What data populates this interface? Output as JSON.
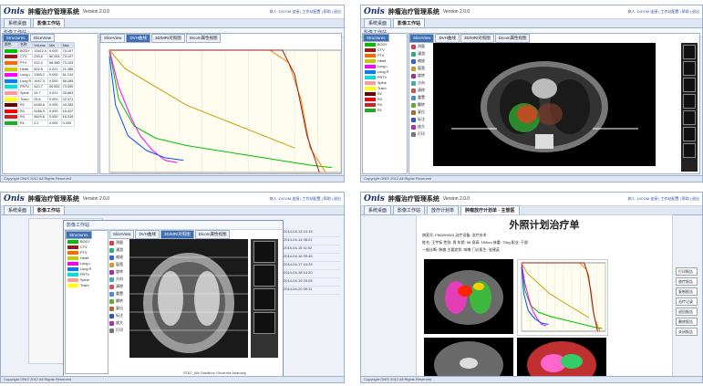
{
  "app": {
    "logo": "Onis",
    "title": "肿瘤治疗管理系统",
    "version": "Version 2.0.0",
    "user_info": "病人: DICOM 连接  |  工作站配置  |  帮助  |  退出",
    "status": "Copyright ONIS 2012 All Rights Reserved"
  },
  "tabs": {
    "home": "系统桌面",
    "workbench": "影像工作站",
    "plan": "放疗计划单",
    "plan2": "肿瘤放疗计划单 - 主管医"
  },
  "workbench_title": "影像工作站",
  "subtabs": {
    "structures": "Structures",
    "slice": "SliceView",
    "dvh": "DVH曲线",
    "view3d": "3D/MRI对照图",
    "dicom": "Dicom属性视图"
  },
  "roi_table": {
    "headers": [
      "颜色",
      "名称",
      "Volume",
      "Min",
      "Max"
    ],
    "rows": [
      {
        "color": "#00c000",
        "name": "BODY",
        "vol": "13412.0",
        "min": "0.000",
        "max": "73.107"
      },
      {
        "color": "#9b1b1b",
        "name": "CTV",
        "vol": "239.6",
        "min": "60.001",
        "max": "73.107"
      },
      {
        "color": "#ff6600",
        "name": "PTV",
        "vol": "512.4",
        "min": "56.980",
        "max": "73.103"
      },
      {
        "color": "#c8c800",
        "name": "Heart",
        "vol": "602.5",
        "min": "0.021",
        "max": "21.386"
      },
      {
        "color": "#ff00ff",
        "name": "Lung L",
        "vol": "1365.2",
        "min": "0.000",
        "max": "61.104"
      },
      {
        "color": "#0080ff",
        "name": "Lung R",
        "vol": "1647.3",
        "min": "0.000",
        "max": "58.285"
      },
      {
        "color": "#00e0e0",
        "name": "PRTV",
        "vol": "410.7",
        "min": "50.502",
        "max": "73.000"
      },
      {
        "color": "#ff9999",
        "name": "Spine",
        "vol": "24.7",
        "min": "0.021",
        "max": "33.663"
      },
      {
        "color": "#ffff00",
        "name": "Trach",
        "vol": "25.6",
        "min": "0.000",
        "max": "22.371"
      },
      {
        "color": "#6a0000",
        "name": "R2",
        "vol": "5185.6",
        "min": "0.000",
        "max": "44.283"
      },
      {
        "color": "#ff0000",
        "name": "R3",
        "vol": "5186.9",
        "min": "0.000",
        "max": "16.427"
      },
      {
        "color": "#cc2222",
        "name": "R4",
        "vol": "5529.6",
        "min": "0.000",
        "max": "16.315"
      },
      {
        "color": "#22aa22",
        "name": "R1",
        "vol": "2.2",
        "min": "0.000",
        "max": "0.000"
      }
    ]
  },
  "chart_data": {
    "type": "line",
    "title": "DVH",
    "xlabel": "Dose",
    "ylabel": "Volume %",
    "xlim": [
      0,
      7500
    ],
    "ylim": [
      0,
      100
    ],
    "series": [
      {
        "color": "#00c000",
        "x": [
          0,
          300,
          800,
          1500,
          2500,
          3500,
          4500,
          5500,
          6500,
          7200
        ],
        "y": [
          100,
          60,
          38,
          28,
          22,
          18,
          14,
          10,
          6,
          4
        ]
      },
      {
        "color": "#ff8000",
        "x": [
          0,
          3000,
          5200,
          5800,
          6200,
          6500,
          7000
        ],
        "y": [
          100,
          100,
          100,
          90,
          60,
          20,
          0
        ]
      },
      {
        "color": "#9b1b1b",
        "x": [
          0,
          3500,
          5600,
          6000,
          6400,
          6800
        ],
        "y": [
          100,
          100,
          100,
          80,
          30,
          0
        ]
      },
      {
        "color": "#ff00ff",
        "x": [
          0,
          300,
          700,
          1000,
          1400,
          1800,
          2200
        ],
        "y": [
          100,
          70,
          45,
          30,
          18,
          10,
          8
        ]
      },
      {
        "color": "#c8a000",
        "x": [
          0,
          500,
          1500,
          2500,
          3500,
          5000,
          6000
        ],
        "y": [
          100,
          85,
          70,
          55,
          45,
          30,
          20
        ]
      },
      {
        "color": "#0050ff",
        "x": [
          0,
          200,
          600,
          1200,
          1800,
          2400
        ],
        "y": [
          95,
          55,
          30,
          18,
          12,
          10
        ]
      }
    ]
  },
  "tools": [
    "测量",
    "漫游",
    "缩放",
    "窗宽",
    "旋转",
    "方向",
    "清除",
    "重置",
    "翻转",
    "复位",
    "标注",
    "放大",
    "打印"
  ],
  "report": {
    "title": "外照计划治疗单",
    "line1": "病案号: FN0209823   治疗设备:             治疗技术:",
    "line2": "姓名: 王宇标   性别: 男   年龄: 58   身高: 169cm   体重: 70kg   职业: 干部",
    "line3": "一般诊断: 肺癌    主要症状: 咳嗽    门诊医生: 张建英",
    "buttons": [
      "打印报告",
      "放疗报告",
      "复制报告",
      "治疗记录",
      "退回报告",
      "删除报告",
      "关闭报告"
    ]
  },
  "list_dates": [
    "2014-04-13 10:15",
    "2014-04-14 08:21",
    "2014-04-15 11:02",
    "2014-04-16 09:45",
    "2014-04-17 10:33",
    "2014-04-18 14:20",
    "2014-04-19 15:05",
    "2014-04-20 09:11"
  ],
  "bottom_info": "STAT_Ath     Sandbox Oncentra Anatomy"
}
